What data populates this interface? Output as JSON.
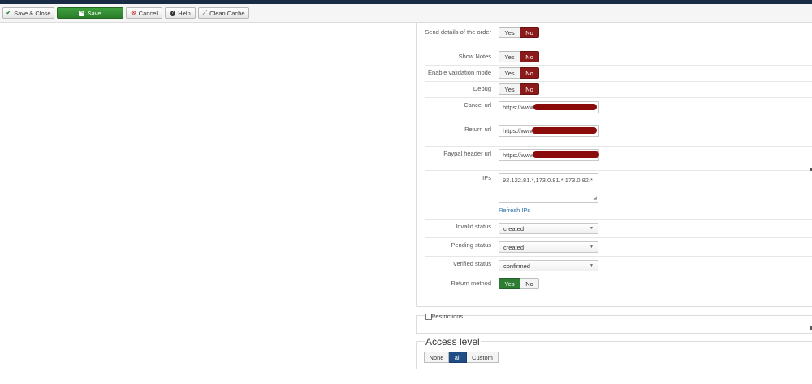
{
  "toolbar": {
    "save_close": "Save & Close",
    "save": "Save",
    "cancel": "Cancel",
    "help": "Help",
    "clean_cache": "Clean Cache"
  },
  "form": {
    "send_details_label": "Send details of the order",
    "show_notes_label": "Show Notes",
    "validation_label": "Enable validation mode",
    "debug_label": "Debug",
    "cancel_url_label": "Cancel url",
    "cancel_url_value": "https://www",
    "return_url_label": "Return url",
    "return_url_value": "https://www",
    "paypal_header_label": "Paypal header url",
    "paypal_header_value": "https://www",
    "ips_label": "IPs",
    "ips_value": "92.122.81.*,173.0.81.*,173.0.82.*",
    "refresh_ips": "Refresh IPs",
    "invalid_status_label": "Invalid status",
    "invalid_status_value": "created",
    "pending_status_label": "Pending status",
    "pending_status_value": "created",
    "verified_status_label": "Verified status",
    "verified_status_value": "confirmed",
    "return_method_label": "Return method",
    "yes": "Yes",
    "no": "No"
  },
  "restrictions": {
    "legend": "Restrictions"
  },
  "access": {
    "title": "Access level",
    "none": "None",
    "all": "all",
    "custom": "Custom"
  },
  "colors": {
    "toggle_no_active": "#8b1a1a",
    "toggle_yes_active": "#2e7d32",
    "save_button": "#3a973a",
    "access_active": "#1f4e86",
    "link": "#2a6fb0"
  }
}
